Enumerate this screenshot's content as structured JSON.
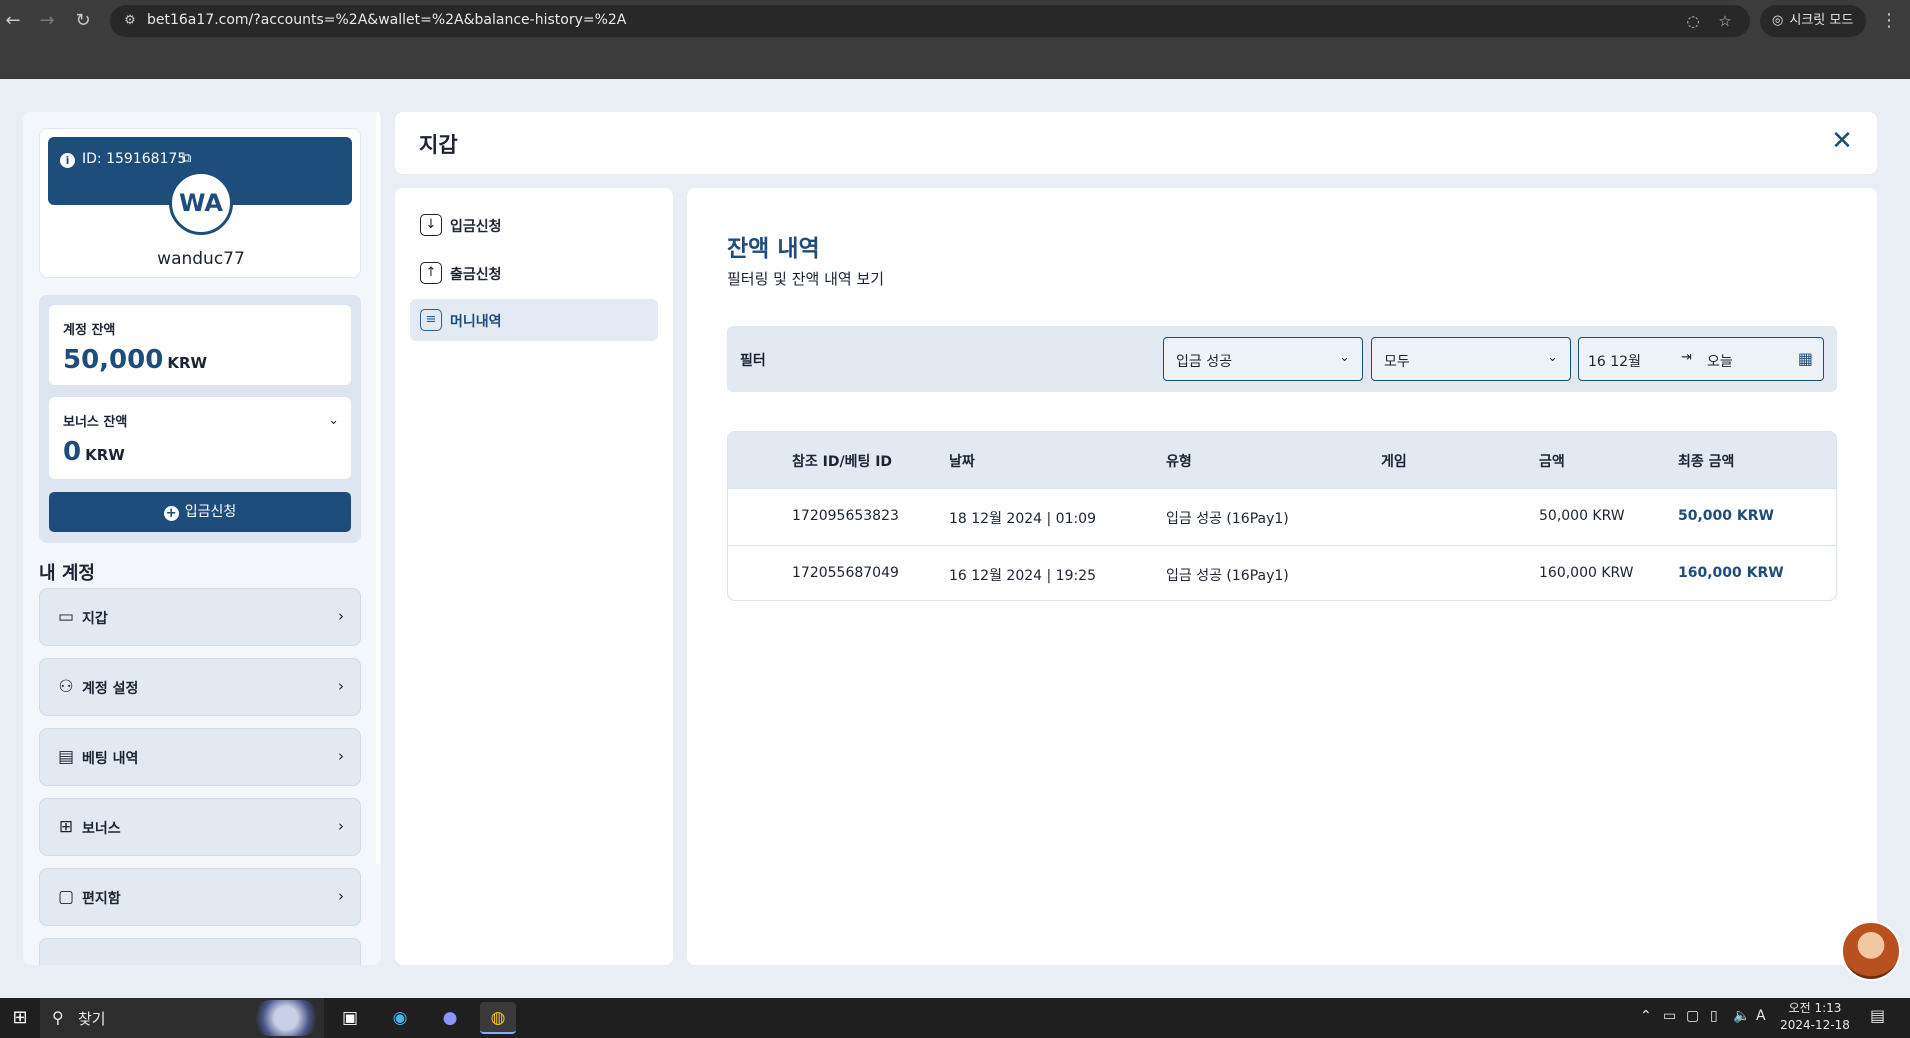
{
  "browser": {
    "url": "bet16a17.com/?accounts=%2A&wallet=%2A&balance-history=%2A",
    "incognito_label": "시크릿 모드"
  },
  "profile": {
    "id_text": "ID: 159168175",
    "avatar_initials": "WA",
    "username": "wanduc77"
  },
  "balances": {
    "account_label": "계정 잔액",
    "account_amount": "50,000",
    "account_currency": "KRW",
    "bonus_label": "보너스 잔액",
    "bonus_amount": "0",
    "bonus_currency": "KRW",
    "deposit_button": "입금신청"
  },
  "my_account": {
    "title": "내 계정",
    "items": [
      {
        "label": "지갑",
        "icon": "wallet-icon"
      },
      {
        "label": "계정 설정",
        "icon": "user-settings-icon"
      },
      {
        "label": "베팅 내역",
        "icon": "receipt-icon"
      },
      {
        "label": "보너스",
        "icon": "gift-icon"
      },
      {
        "label": "편지함",
        "icon": "message-icon"
      }
    ]
  },
  "wallet": {
    "title": "지갑",
    "nav": [
      {
        "label": "입금신청",
        "icon": "download-icon"
      },
      {
        "label": "출금신청",
        "icon": "upload-icon"
      },
      {
        "label": "머니내역",
        "icon": "document-icon"
      }
    ]
  },
  "history": {
    "title": "잔액 내역",
    "subtitle": "필터링 및 잔액 내역 보기",
    "filter_label": "필터",
    "status_select": "입금 성공",
    "type_select": "모두",
    "date_from": "16 12월",
    "date_to": "오늘",
    "columns": [
      "참조 ID/베팅 ID",
      "날짜",
      "유형",
      "게임",
      "금액",
      "최종 금액"
    ],
    "rows": [
      {
        "ref": "172095653823",
        "date": "18 12월 2024 | 01:09",
        "type": "입금 성공 (16Pay1)",
        "game": "",
        "amount": "50,000 KRW",
        "final": "50,000 KRW"
      },
      {
        "ref": "172055687049",
        "date": "16 12월 2024 | 19:25",
        "type": "입금 성공 (16Pay1)",
        "game": "",
        "amount": "160,000 KRW",
        "final": "160,000 KRW"
      }
    ]
  },
  "taskbar": {
    "search_text": "찾기",
    "clock_time": "오전 1:13",
    "clock_date": "2024-12-18",
    "ime": "A"
  },
  "colors": {
    "brand": "#1e4d7b",
    "panel": "#e2e9f1"
  }
}
